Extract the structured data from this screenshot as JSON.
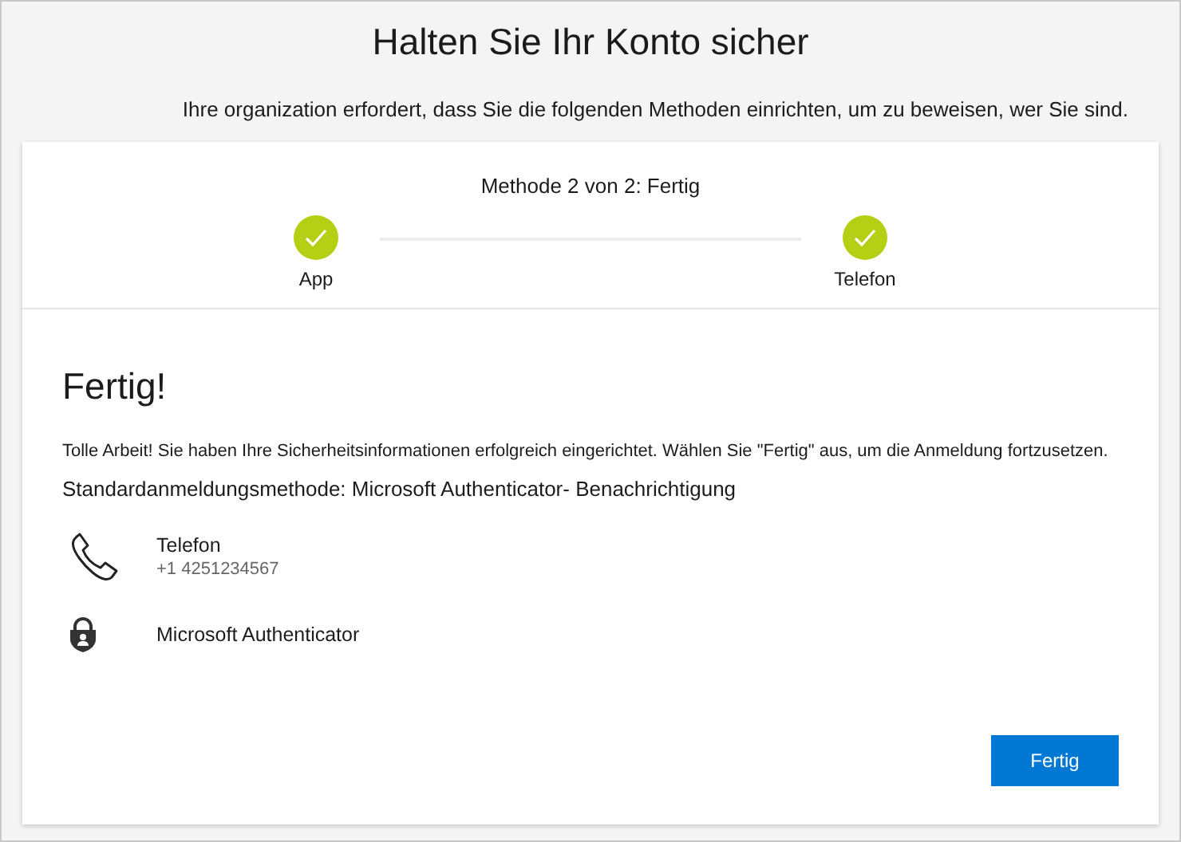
{
  "title": "Halten Sie Ihr Konto sicher",
  "subtitle": "Ihre organization erfordert, dass Sie die folgenden Methoden einrichten, um zu beweisen, wer Sie sind.",
  "progress": {
    "label": "Methode 2 von 2: Fertig",
    "steps": [
      {
        "label": "App",
        "completed": true
      },
      {
        "label": "Telefon",
        "completed": true
      }
    ]
  },
  "heading": "Fertig!",
  "message": "Tolle Arbeit! Sie haben Ihre Sicherheitsinformationen erfolgreich eingerichtet. Wählen Sie \"Fertig\" aus, um die Anmeldung fortzusetzen.",
  "default_method": "Standardanmeldungsmethode: Microsoft Authenticator- Benachrichtigung",
  "methods": [
    {
      "kind": "phone",
      "name": "Telefon",
      "detail": "+1 4251234567"
    },
    {
      "kind": "authenticator",
      "name": "Microsoft Authenticator"
    }
  ],
  "button": "Fertig"
}
